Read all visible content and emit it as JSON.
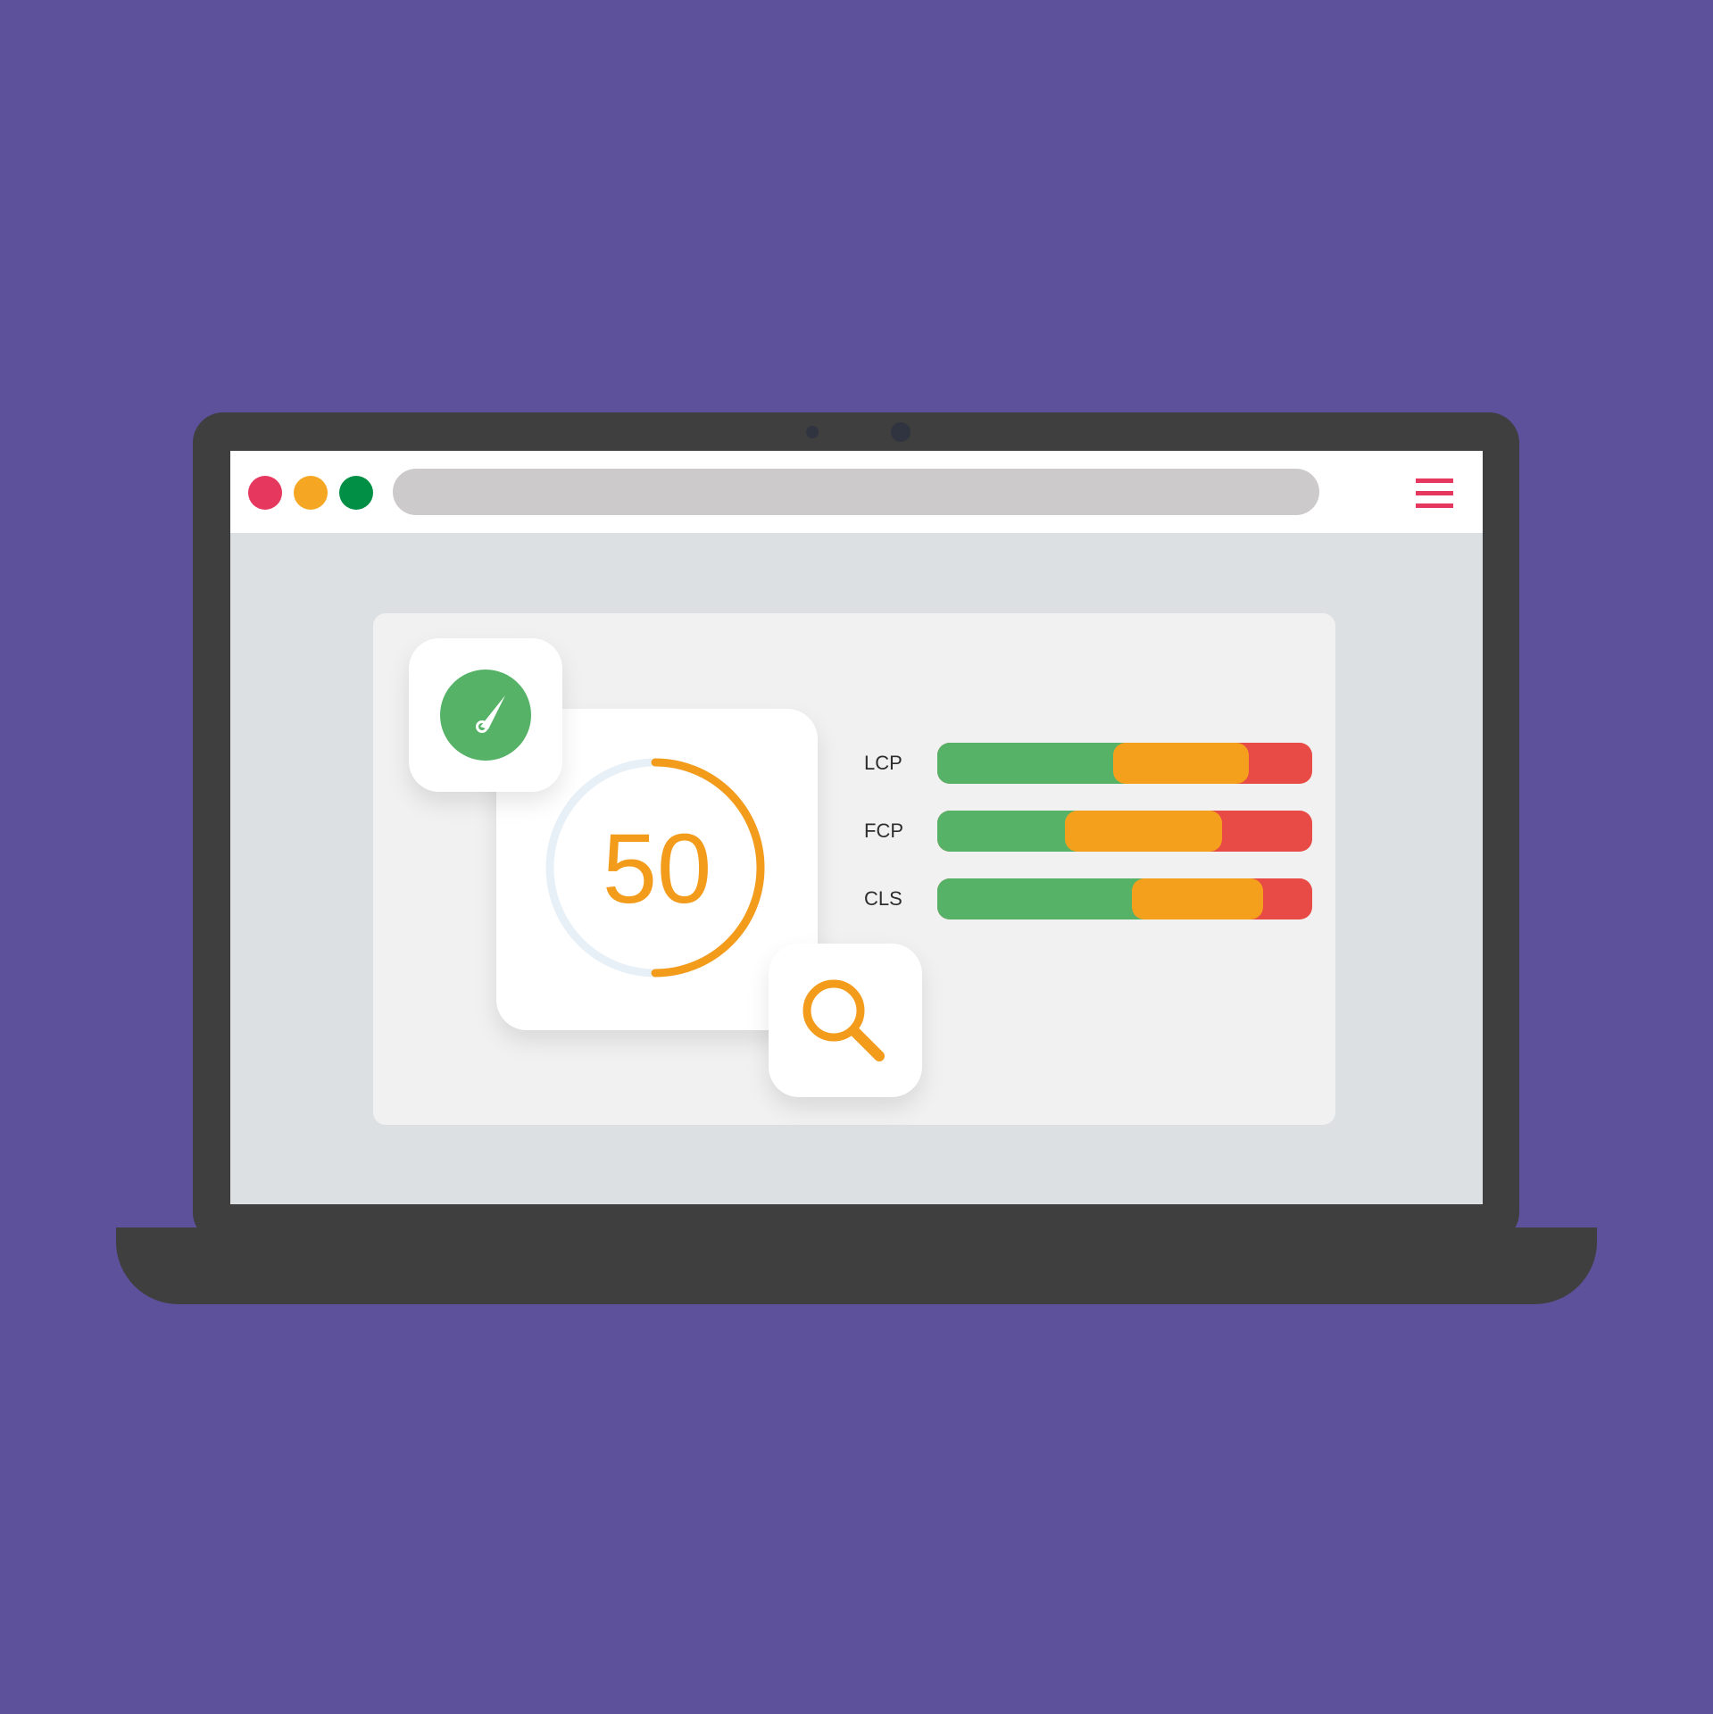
{
  "browser": {
    "traffic_lights": [
      {
        "name": "close",
        "color": "#e6385f"
      },
      {
        "name": "minimize",
        "color": "#f5a623"
      },
      {
        "name": "maximize",
        "color": "#008f45"
      }
    ],
    "address_bar": {
      "value": ""
    },
    "menu_icon": "hamburger-menu-icon",
    "accent_color": "#e6385f"
  },
  "dashboard": {
    "gauge_icon": "speedometer-icon",
    "search_icon": "magnifier-icon",
    "score": {
      "value": "50",
      "fraction": 0.5,
      "color": "#f39b1a"
    },
    "metrics": [
      {
        "label": "LCP",
        "good": 0.47,
        "needs_improvement_end": 0.83
      },
      {
        "label": "FCP",
        "good": 0.34,
        "needs_improvement_end": 0.76
      },
      {
        "label": "CLS",
        "good": 0.52,
        "needs_improvement_end": 0.87
      }
    ],
    "colors": {
      "good": "#56b266",
      "average": "#f4a01c",
      "poor": "#e84a45"
    }
  }
}
